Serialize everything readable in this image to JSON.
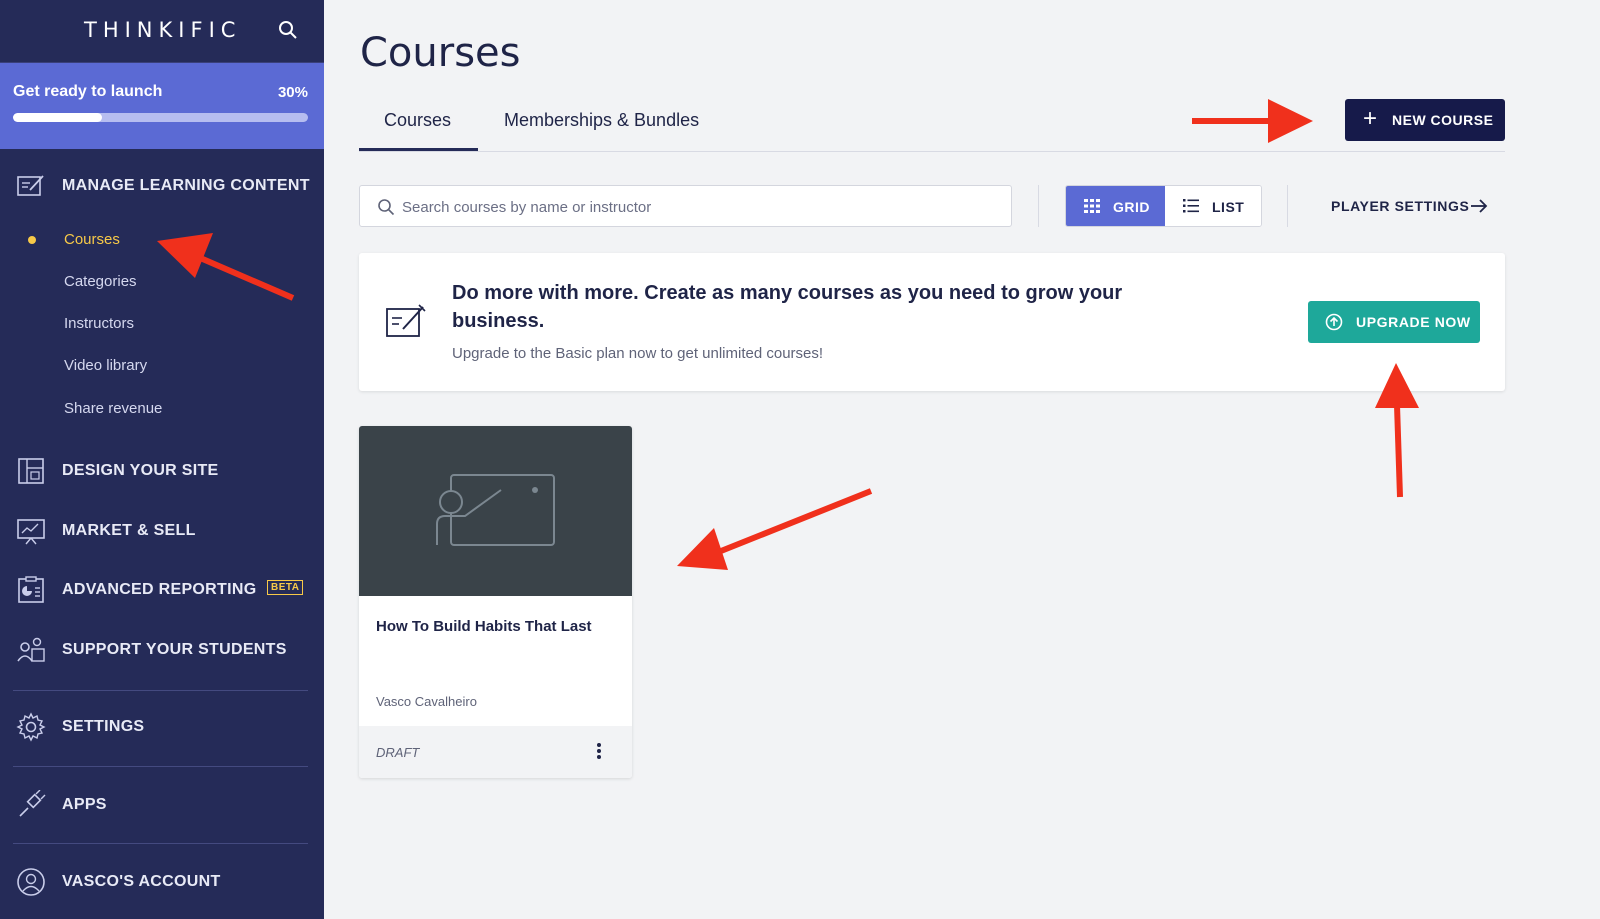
{
  "sidebar": {
    "brand": "THINKIFIC",
    "launch": {
      "title": "Get ready to launch",
      "percent_label": "30%",
      "progress": 0.3
    },
    "sections": {
      "manage": "MANAGE LEARNING CONTENT",
      "design": "DESIGN YOUR SITE",
      "market": "MARKET & SELL",
      "reporting": "ADVANCED REPORTING",
      "reporting_badge": "BETA",
      "support": "SUPPORT YOUR STUDENTS",
      "settings": "SETTINGS",
      "apps": "APPS",
      "account": "VASCO'S ACCOUNT"
    },
    "sub_items": [
      "Courses",
      "Categories",
      "Instructors",
      "Video library",
      "Share revenue"
    ]
  },
  "main": {
    "title": "Courses",
    "tabs": [
      "Courses",
      "Memberships & Bundles"
    ],
    "new_course_label": "NEW COURSE",
    "search_placeholder": "Search courses by name or instructor",
    "view_toggle": {
      "grid": "GRID",
      "list": "LIST"
    },
    "player_settings": "PLAYER SETTINGS",
    "upgrade": {
      "headline": "Do more with more. Create as many courses as you need to grow your business.",
      "subtext": "Upgrade to the Basic plan now to get unlimited courses!",
      "button": "UPGRADE NOW"
    },
    "course": {
      "title": "How To Build Habits That Last",
      "author": "Vasco Cavalheiro",
      "status": "DRAFT"
    }
  },
  "colors": {
    "sidebar_bg": "#252b58",
    "accent": "#5b6ad4",
    "active": "#f7c948",
    "primary_button": "#161a4a",
    "upgrade_button": "#1ea89a",
    "annotation_arrow": "#f0301c"
  }
}
